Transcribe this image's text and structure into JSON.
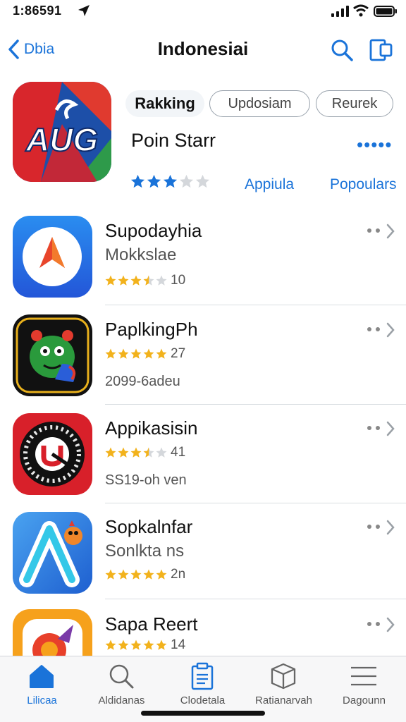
{
  "status_bar": {
    "time": "1:86591"
  },
  "nav": {
    "back_label": "Dbia",
    "title": "Indonesiai"
  },
  "featured": {
    "chip_ranking": "Rakking",
    "chip_2": "Updosiam",
    "chip_3": "Reurek",
    "name": "Poin Starr",
    "more": "•••••",
    "rating": 3,
    "link_1": "Appiula",
    "link_2": "Popoulars",
    "icon_text": "AUG"
  },
  "apps": [
    {
      "name": "Supodayhia",
      "subtitle": "Mokkslae",
      "rating": 3.5,
      "rating_count": "10"
    },
    {
      "name": "PaplkingPh",
      "rating": 5,
      "rating_count": "27",
      "detail": "2099-6adeu"
    },
    {
      "name": "Appikasisin",
      "rating": 3.5,
      "rating_count": "41",
      "detail": "SS19-oh ven"
    },
    {
      "name": "Sopkalnfar",
      "subtitle": "Sonlkta ns",
      "rating": 5,
      "rating_count": "2n"
    },
    {
      "name": "Sapa Reert",
      "rating": 5,
      "rating_count": "14"
    }
  ],
  "tabs": [
    {
      "label": "Lilicaa",
      "icon": "home-icon"
    },
    {
      "label": "Aldidanas",
      "icon": "search-icon"
    },
    {
      "label": "Clodetala",
      "icon": "clipboard-icon"
    },
    {
      "label": "Ratianarvah",
      "icon": "box-icon"
    },
    {
      "label": "Dagounn",
      "icon": "menu-icon"
    }
  ],
  "colors": {
    "accent": "#1a73d9",
    "star_gold": "#f2b21c",
    "star_blue": "#1a73d9",
    "star_empty": "#d4d7db"
  }
}
